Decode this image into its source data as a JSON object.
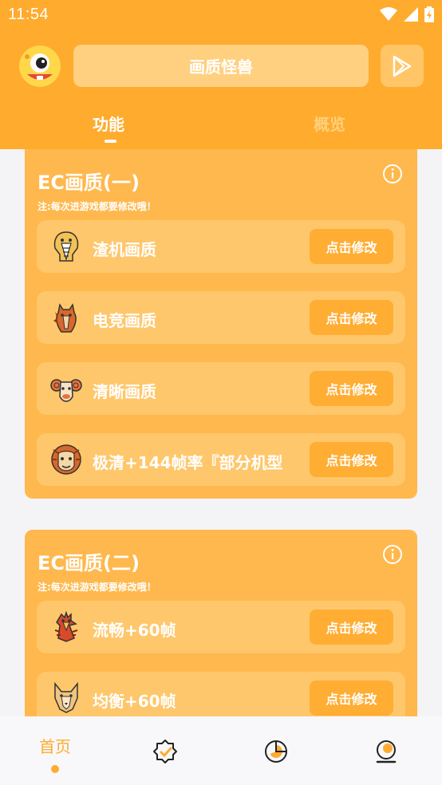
{
  "status_bar": {
    "time": "11:54"
  },
  "header": {
    "title": "画质怪兽"
  },
  "tabs": [
    {
      "label": "功能"
    },
    {
      "label": "概览"
    }
  ],
  "sections": [
    {
      "title": "EC画质(一)",
      "note": "注:每次进游戏都要修改哦！",
      "items": [
        {
          "label": "渣机画质",
          "button": "点击修改",
          "icon": "cobra-icon"
        },
        {
          "label": "电竞画质",
          "button": "点击修改",
          "icon": "horse-icon"
        },
        {
          "label": "清晰画质",
          "button": "点击修改",
          "icon": "ram-icon"
        },
        {
          "label": "极清+144帧率『部分机型",
          "button": "点击修改",
          "icon": "monkey-icon"
        }
      ]
    },
    {
      "title": "EC画质(二)",
      "note": "注:每次进游戏都要修改哦！",
      "items": [
        {
          "label": "流畅+60帧",
          "button": "点击修改",
          "icon": "rooster-icon"
        },
        {
          "label": "均衡+60帧",
          "button": "点击修改",
          "icon": "wolf-icon"
        }
      ]
    }
  ],
  "bottom_nav": [
    {
      "label": "首页",
      "icon": "home",
      "active": true
    },
    {
      "icon": "verified-badge-icon"
    },
    {
      "icon": "pie-chart-icon"
    },
    {
      "icon": "profile-icon"
    }
  ],
  "colors": {
    "primary": "#ffab2e",
    "card": "#ffb84d",
    "row": "#ffc76b",
    "button": "#ffad33"
  }
}
